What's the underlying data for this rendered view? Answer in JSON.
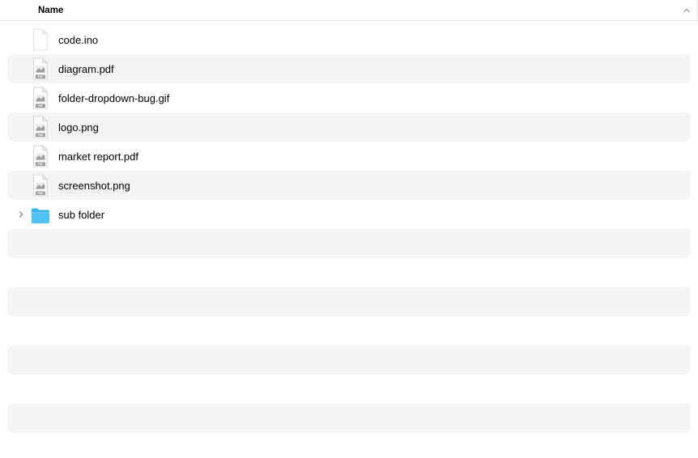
{
  "columns": {
    "name": {
      "label": "Name",
      "sort": "asc"
    }
  },
  "rows": [
    {
      "name": "code.ino",
      "icon": "blank",
      "expandable": false
    },
    {
      "name": "diagram.pdf",
      "icon": "pdf",
      "expandable": false
    },
    {
      "name": "folder-dropdown-bug.gif",
      "icon": "gif",
      "expandable": false
    },
    {
      "name": "logo.png",
      "icon": "png",
      "expandable": false
    },
    {
      "name": "market report.pdf",
      "icon": "pdf",
      "expandable": false
    },
    {
      "name": "screenshot.png",
      "icon": "png",
      "expandable": false
    },
    {
      "name": "sub folder",
      "icon": "folder",
      "expandable": true
    }
  ],
  "empty_row_count": 8
}
